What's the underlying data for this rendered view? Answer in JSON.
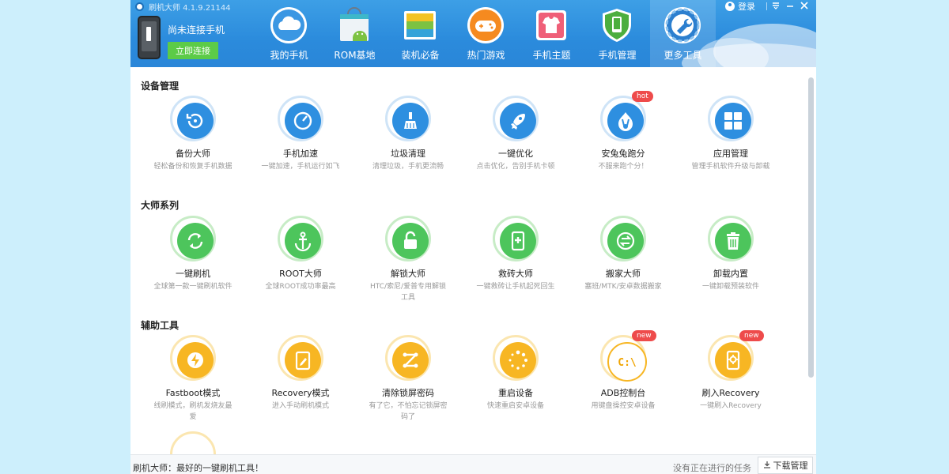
{
  "window": {
    "title": "刷机大师 4.1.9.21144",
    "login_label": "登录"
  },
  "device": {
    "status_text": "尚未连接手机",
    "connect_label": "立即连接"
  },
  "nav": [
    {
      "label": "我的手机",
      "icon": "cloud-icon"
    },
    {
      "label": "ROM基地",
      "icon": "shopping-bag-android-icon"
    },
    {
      "label": "装机必备",
      "icon": "layers-icon"
    },
    {
      "label": "热门游戏",
      "icon": "gamepad-icon"
    },
    {
      "label": "手机主题",
      "icon": "tshirt-icon"
    },
    {
      "label": "手机管理",
      "icon": "shield-phone-icon"
    },
    {
      "label": "更多工具",
      "icon": "wrench-gear-icon",
      "active": true
    }
  ],
  "sections": [
    {
      "title": "设备管理",
      "tools": [
        {
          "name": "备份大师",
          "desc": "轻松备份和恢复手机数据",
          "icon": "backup-icon"
        },
        {
          "name": "手机加速",
          "desc": "一键加速，手机运行如飞",
          "icon": "speedometer-icon"
        },
        {
          "name": "垃圾清理",
          "desc": "清理垃圾，手机更流畅",
          "icon": "broom-icon"
        },
        {
          "name": "一键优化",
          "desc": "点击优化，告别手机卡顿",
          "icon": "rocket-icon"
        },
        {
          "name": "安兔兔跑分",
          "desc": "不服来跑个分！",
          "icon": "rabbit-flame-icon",
          "badge": "hot"
        },
        {
          "name": "应用管理",
          "desc": "管理手机软件升级与卸载",
          "icon": "apps-grid-icon"
        }
      ]
    },
    {
      "title": "大师系列",
      "tools": [
        {
          "name": "一键刷机",
          "desc": "全球第一款一键刷机软件",
          "icon": "refresh-icon"
        },
        {
          "name": "ROOT大师",
          "desc": "全球ROOT成功率最高",
          "icon": "anchor-icon"
        },
        {
          "name": "解锁大师",
          "desc": "HTC/索尼/爱普专用解锁工具",
          "icon": "unlock-icon"
        },
        {
          "name": "救砖大师",
          "desc": "一键救砖让手机起死回生",
          "icon": "phone-medical-icon"
        },
        {
          "name": "搬家大师",
          "desc": "塞班/MTK/安卓数据搬家",
          "icon": "transfer-icon"
        },
        {
          "name": "卸载内置",
          "desc": "一键卸载预装软件",
          "icon": "trash-icon"
        }
      ]
    },
    {
      "title": "辅助工具",
      "tools": [
        {
          "name": "Fastboot模式",
          "desc": "线刷模式，刷机发烧友最爱",
          "icon": "lightning-icon"
        },
        {
          "name": "Recovery模式",
          "desc": "进入手动刷机模式",
          "icon": "tablet-edit-icon"
        },
        {
          "name": "清除锁屏密码",
          "desc": "有了它，不怕忘记锁屏密码了",
          "icon": "pattern-lock-icon"
        },
        {
          "name": "重启设备",
          "desc": "快速重启安卓设备",
          "icon": "loading-icon"
        },
        {
          "name": "ADB控制台",
          "desc": "用键盘操控安卓设备",
          "icon": "terminal-icon",
          "badge": "new"
        },
        {
          "name": "刷入Recovery",
          "desc": "一键刷入Recovery",
          "icon": "phone-gear-icon",
          "badge": "new"
        }
      ]
    }
  ],
  "status": {
    "left_text": "刷机大师：最好的一键刷机工具！",
    "task_text": "没有正在进行的任务",
    "download_label": "下载管理"
  }
}
